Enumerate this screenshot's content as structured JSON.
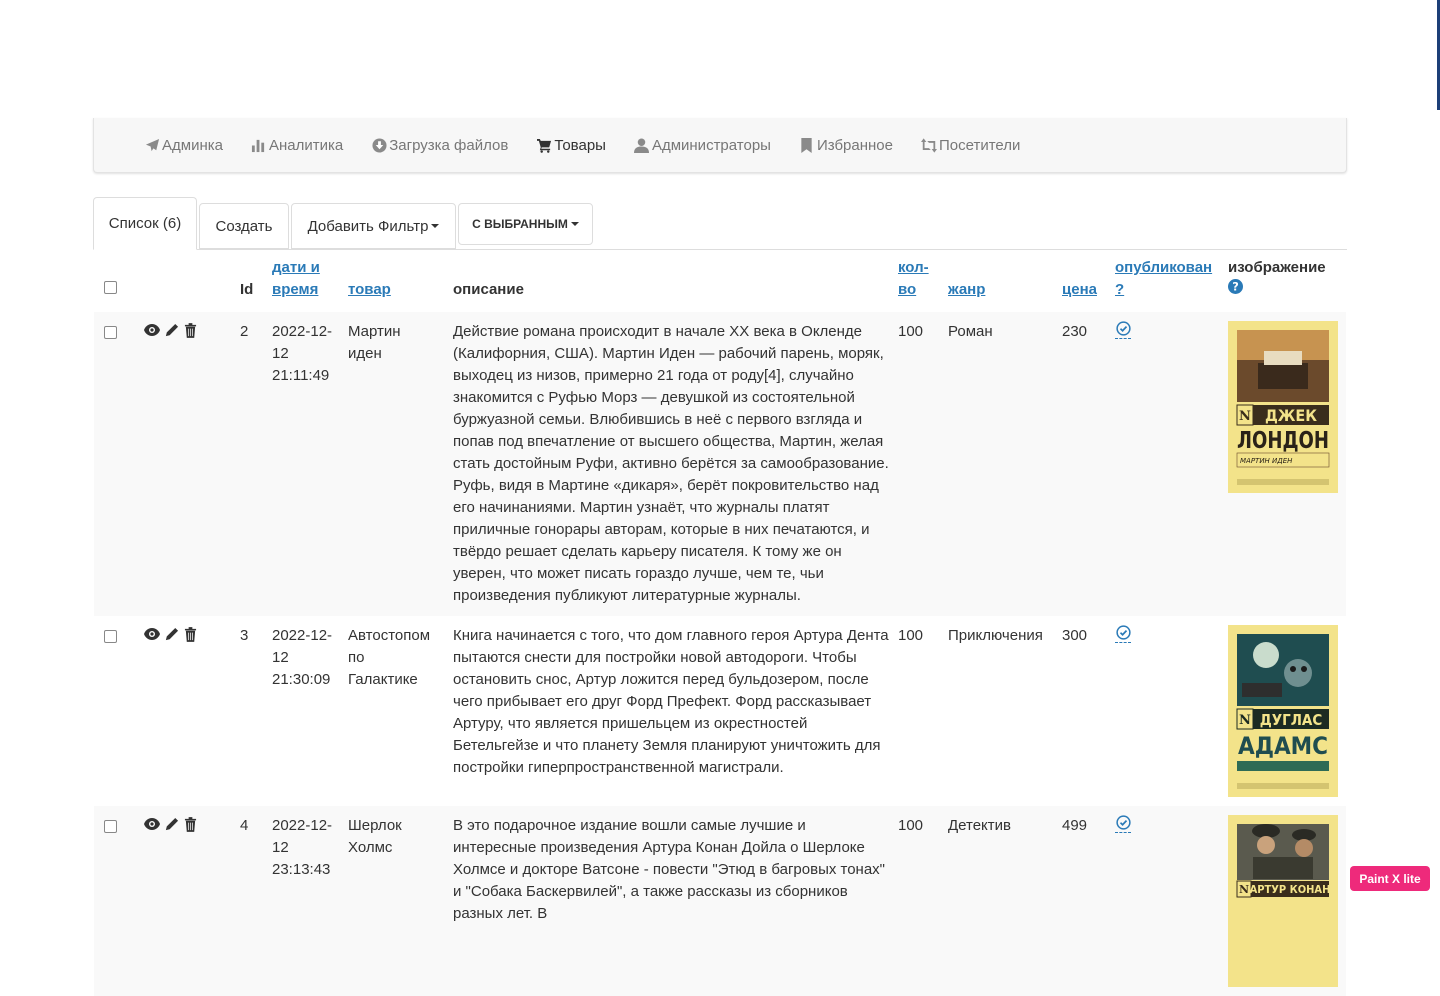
{
  "nav": {
    "items": [
      {
        "label": "Админка",
        "icon": "paper-plane-icon"
      },
      {
        "label": "Аналитика",
        "icon": "bar-chart-icon"
      },
      {
        "label": "Загрузка файлов",
        "icon": "download-circle-icon"
      },
      {
        "label": "Товары",
        "icon": "shopping-cart-icon"
      },
      {
        "label": "Администраторы",
        "icon": "user-icon"
      },
      {
        "label": "Избранное",
        "icon": "bookmark-icon"
      },
      {
        "label": "Посетители",
        "icon": "retweet-icon"
      }
    ],
    "active_index": 3
  },
  "tabs": {
    "list": "Список (6)",
    "create": "Создать",
    "add_filter": "Добавить Фильтр",
    "bulk": "С ВЫБРАННЫМ"
  },
  "table": {
    "headers": {
      "id": "Id",
      "datetime": "дати и время",
      "product": "товар",
      "description": "описание",
      "qty": "кол-во",
      "genre": "жанр",
      "price": "цена",
      "published": "опубликован ?",
      "image": "изображение"
    },
    "rows": [
      {
        "id": "2",
        "date": "2022-12-",
        "date2": "12",
        "time": "21:11:49",
        "product": "Мартин иден",
        "description": "Действие романа происходит в начале XX века в Окленде (Калифорния, США). Мартин Иден — рабочий парень, моряк, выходец из низов, примерно 21 года от роду[4], случайно знакомится с Руфью Морз — девушкой из состоятельной буржуазной семьи. Влюбившись в неё с первого взгляда и попав под впечатление от высшего общества, Мартин, желая стать достойным Руфи, активно берётся за самообразование. Руфь, видя в Мартине «дикаря», берёт покровительство над его начинаниями. Мартин узнаёт, что журналы платят приличные гонорары авторам, которые в них печатаются, и твёрдо решает сделать карьеру писателя. К тому же он уверен, что может писать гораздо лучше, чем те, чьи произведения публикуют литературные журналы.",
        "qty": "100",
        "genre": "Роман",
        "price": "230",
        "cover": {
          "author_first": "ДЖЕК",
          "author_last": "ЛОНДОН",
          "title": "МАРТИН ИДЕН",
          "bg": "#f3e38a"
        }
      },
      {
        "id": "3",
        "date": "2022-12-",
        "date2": "12",
        "time": "21:30:09",
        "product": "Автостопом по Галактике",
        "description": "Книга начинается с того, что дом главного героя Артура Дента пытаются снести для постройки новой автодороги. Чтобы остановить снос, Артур ложится перед бульдозером, после чего прибывает его друг Форд Префект. Форд рассказывает Артуру, что является пришельцем из окрестностей Бетельгейзе и что планету Земля планируют уничтожить для постройки гиперпространственной магистрали.",
        "qty": "100",
        "genre": "Приключения",
        "price": "300",
        "cover": {
          "author_first": "ДУГЛАС",
          "author_last": "АДАМС",
          "title": "",
          "bg": "#f3e38a"
        }
      },
      {
        "id": "4",
        "date": "2022-12-",
        "date2": "12",
        "time": "23:13:43",
        "product": "Шерлок Холмс",
        "description": "В это подарочное издание вошли самые лучшие и интересные произведения Артура Конан Дойла о Шерлоке Холмсе и докторе Ватсоне - повести \"Этюд в багровых тонах\" и \"Собака Баскервилей\", а также рассказы из сборников разных лет. В",
        "qty": "100",
        "genre": "Детектив",
        "price": "499",
        "cover": {
          "author_first": "АРТУР КОНАН",
          "author_last": "",
          "title": "",
          "bg": "#f3e38a"
        }
      }
    ]
  },
  "badge": "Paint X lite",
  "colors": {
    "link": "#2a7ab7",
    "nav_bg": "#f7f7f7",
    "stripe": "#f9f9f9",
    "badge": "#ee2a7b"
  }
}
